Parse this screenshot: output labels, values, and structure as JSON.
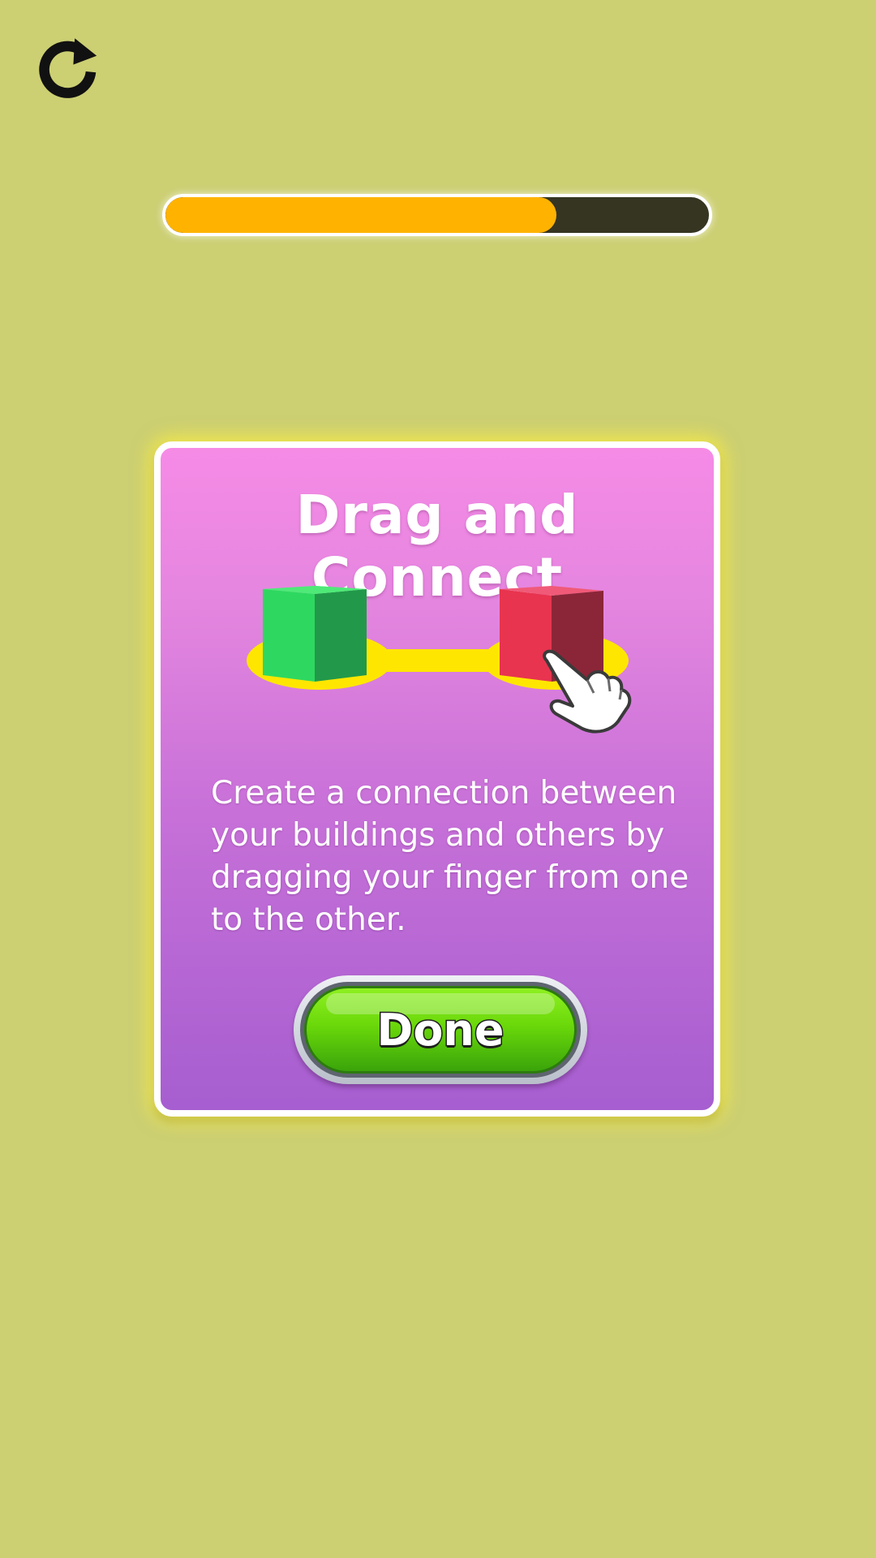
{
  "header": {
    "restart_icon": "restart-icon"
  },
  "progress": {
    "value_fraction": 0.72,
    "fill_color": "#ffb300",
    "track_color": "#353522"
  },
  "tutorial": {
    "title": "Drag and Connect",
    "illustration": {
      "left_block_color": "#2ed860",
      "right_block_color": "#e8344f",
      "connector_color": "#ffe600",
      "hand_icon": "pointing-hand-icon"
    },
    "description": "Create a connection between your buildings and others by dragging your finger from one to the other.",
    "done_label": "Done"
  },
  "colors": {
    "background": "#cccf72",
    "card_top": "#f68be6",
    "card_bottom": "#a65ed0",
    "button_green": "#6ad80a"
  }
}
